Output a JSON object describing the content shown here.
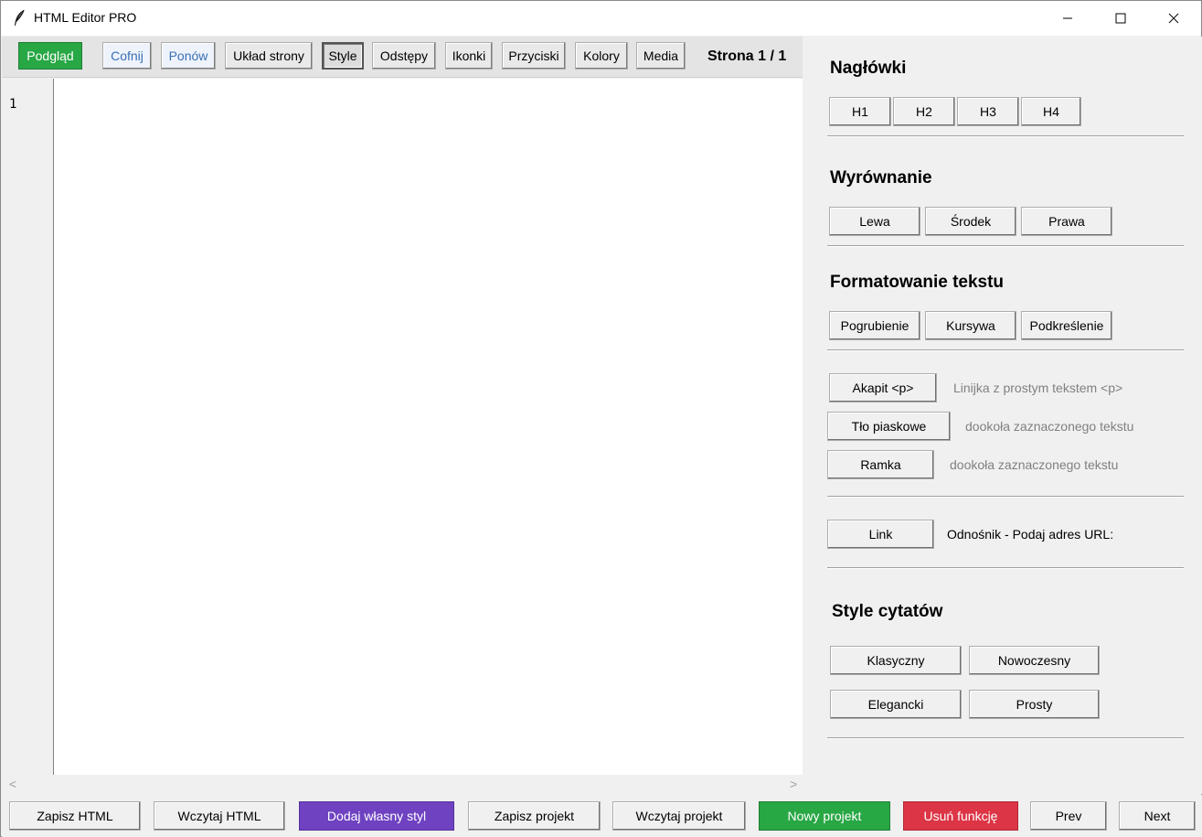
{
  "window": {
    "title": "HTML Editor PRO",
    "controls": {
      "minimize": "–",
      "maximize": "☐",
      "close": "✕"
    }
  },
  "toolbar": {
    "preview": "Podgląd",
    "undo": "Cofnij",
    "redo": "Ponów",
    "layout": "Układ strony",
    "style": "Style",
    "spacing": "Odstępy",
    "icons": "Ikonki",
    "buttons": "Przyciski",
    "colors": "Kolory",
    "media": "Media",
    "page_indicator": "Strona 1 / 1"
  },
  "editor": {
    "line_numbers": [
      "1"
    ],
    "content": ""
  },
  "panel": {
    "headings": {
      "title": "Nagłówki",
      "buttons": [
        "H1",
        "H2",
        "H3",
        "H4"
      ]
    },
    "alignment": {
      "title": "Wyrównanie",
      "buttons": [
        "Lewa",
        "Środek",
        "Prawa"
      ]
    },
    "formatting": {
      "title": "Formatowanie tekstu",
      "buttons": [
        "Pogrubienie",
        "Kursywa",
        "Podkreślenie"
      ]
    },
    "blocks": {
      "paragraph_button": "Akapit <p>",
      "paragraph_hint": "Linijka z prostym tekstem  <p>",
      "sand_bg_button": "Tło piaskowe",
      "sand_bg_hint": "dookoła zaznaczonego tekstu",
      "frame_button": "Ramka",
      "frame_hint": "dookoła zaznaczonego tekstu"
    },
    "link": {
      "button": "Link",
      "label": "Odnośnik - Podaj adres URL:"
    },
    "quotes": {
      "title": "Style cytatów",
      "buttons": [
        "Klasyczny",
        "Nowoczesny",
        "Elegancki",
        "Prosty"
      ]
    }
  },
  "bottombar": {
    "save_html": "Zapisz HTML",
    "load_html": "Wczytaj HTML",
    "add_style": "Dodaj własny styl",
    "save_project": "Zapisz projekt",
    "load_project": "Wczytaj projekt",
    "new_project": "Nowy projekt",
    "remove_functions": "Usuń funkcję",
    "prev": "Prev",
    "next": "Next"
  },
  "colors": {
    "green": "#28a745",
    "purple": "#6f42c1",
    "red": "#dc3545",
    "link_blue": "#3a6fb5"
  }
}
